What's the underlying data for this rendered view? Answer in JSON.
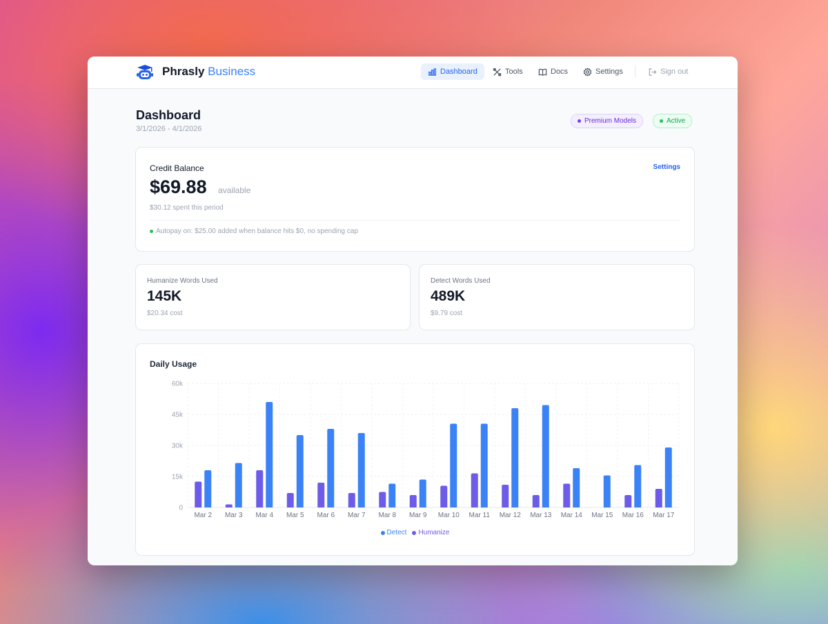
{
  "brand": {
    "name": "Phrasly",
    "suffix": "Business"
  },
  "nav": {
    "dashboard": "Dashboard",
    "tools": "Tools",
    "docs": "Docs",
    "settings": "Settings",
    "signout": "Sign out"
  },
  "page": {
    "title": "Dashboard",
    "date_range": "3/1/2026 - 4/1/2026",
    "badges": {
      "premium": "Premium Models",
      "status": "Active"
    }
  },
  "credit": {
    "title": "Credit Balance",
    "settings_link": "Settings",
    "amount": "$69.88",
    "available": "available",
    "spent": "$30.12 spent this period",
    "autopay": "Autopay on: $25.00 added when balance hits $0, no spending cap"
  },
  "stats": {
    "humanize": {
      "label": "Humanize Words Used",
      "value": "145K",
      "cost": "$20.34 cost"
    },
    "detect": {
      "label": "Detect Words Used",
      "value": "489K",
      "cost": "$9.79 cost"
    }
  },
  "colors": {
    "detect": "#3b82f6",
    "humanize": "#6c5ce7",
    "accent": "#2563eb"
  },
  "chart_data": {
    "type": "bar",
    "title": "Daily Usage",
    "categories": [
      "Mar 2",
      "Mar 3",
      "Mar 4",
      "Mar 5",
      "Mar 6",
      "Mar 7",
      "Mar 8",
      "Mar 9",
      "Mar 10",
      "Mar 11",
      "Mar 12",
      "Mar 13",
      "Mar 14",
      "Mar 15",
      "Mar 16",
      "Mar 17"
    ],
    "series": [
      {
        "name": "Humanize",
        "values": [
          12500,
          1500,
          18000,
          7000,
          12000,
          7000,
          7500,
          6000,
          10500,
          16500,
          11000,
          6000,
          11500,
          0,
          6000,
          9000
        ]
      },
      {
        "name": "Detect",
        "values": [
          18000,
          21500,
          51000,
          35000,
          38000,
          36000,
          11500,
          13500,
          40500,
          40500,
          48000,
          49500,
          19000,
          15500,
          20500,
          29000
        ]
      }
    ],
    "yticks": [
      "0",
      "15k",
      "30k",
      "45k",
      "60k"
    ],
    "ylim": [
      0,
      60000
    ],
    "legend": [
      "Detect",
      "Humanize"
    ],
    "legend_position": "bottom-center",
    "grid": true
  }
}
